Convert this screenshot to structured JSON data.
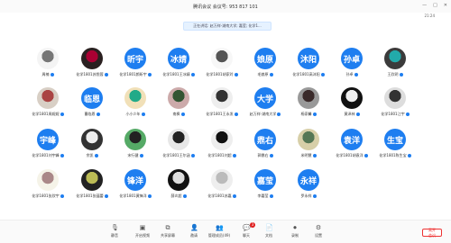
{
  "title": "腾讯会议 会议号: 953 817 101",
  "status_time": "21:24",
  "speaking_text": "正在讲话: 赵万祥-湖南大学; 嘉莹; 化学1...",
  "participants": [
    {
      "name": "周楠",
      "type": "photo",
      "c1": "#f4f4f4",
      "c2": "#777"
    },
    {
      "name": "化学1801苏悦蓉",
      "type": "photo",
      "c1": "#2a2020",
      "c2": "#a03"
    },
    {
      "name": "化学1801颜昕宇",
      "type": "blue",
      "text": "昕宇"
    },
    {
      "name": "化学1801王冰婧",
      "type": "blue",
      "text": "冰婧"
    },
    {
      "name": "化学1801胡家玲",
      "type": "photo",
      "c1": "#f7f7f7",
      "c2": "#555"
    },
    {
      "name": "毛娘原",
      "type": "blue",
      "text": "娘原"
    },
    {
      "name": "化学1801高沐阳",
      "type": "blue",
      "text": "沐阳"
    },
    {
      "name": "孙卓",
      "type": "blue",
      "text": "孙卓"
    },
    {
      "name": "王欣玥",
      "type": "photo",
      "c1": "#3b3b3b",
      "c2": "#2aa"
    },
    {
      "name": "化学1801周妮妮",
      "type": "photo",
      "c1": "#d8cfc5",
      "c2": "#a44"
    },
    {
      "name": "曹临恩",
      "type": "blue",
      "text": "临恩"
    },
    {
      "name": "小小少年",
      "type": "photo",
      "c1": "#f1e0b8",
      "c2": "#2a8"
    },
    {
      "name": "南枫",
      "type": "photo",
      "c1": "#caa",
      "c2": "#353"
    },
    {
      "name": "化学1801王永发",
      "type": "photo",
      "c1": "#eee",
      "c2": "#333"
    },
    {
      "name": "赵万祥-湖南大学",
      "type": "blue",
      "text": "大学"
    },
    {
      "name": "杨家馨",
      "type": "photo",
      "c1": "#999",
      "c2": "#3a2a2a"
    },
    {
      "name": "黄泽林",
      "type": "photo",
      "c1": "#111",
      "c2": "#eee"
    },
    {
      "name": "化学1801江宇",
      "type": "photo",
      "c1": "#ddd",
      "c2": "#333"
    },
    {
      "name": "化学1801刘宇峰",
      "type": "blue",
      "text": "宇峰"
    },
    {
      "name": "余凯",
      "type": "photo",
      "c1": "#333",
      "c2": "#eee"
    },
    {
      "name": "宋行健",
      "type": "photo",
      "c1": "#5a6",
      "c2": "#222"
    },
    {
      "name": "化学1801王尔涵",
      "type": "photo",
      "c1": "#e7e7e7",
      "c2": "#222"
    },
    {
      "name": "化学1801刘超",
      "type": "photo",
      "c1": "#eee",
      "c2": "#111"
    },
    {
      "name": "郭鼎右",
      "type": "blue",
      "text": "鼎右"
    },
    {
      "name": "米明慧",
      "type": "photo",
      "c1": "#d7cfa8",
      "c2": "#575"
    },
    {
      "name": "化学1801胡袁洋",
      "type": "blue",
      "text": "袁洋"
    },
    {
      "name": "化学1801陈生宝",
      "type": "blue",
      "text": "生宝"
    },
    {
      "name": "化学1801张欣宇",
      "type": "photo",
      "c1": "#f5f3e8",
      "c2": "#a88"
    },
    {
      "name": "化学1801张蕴蕾",
      "type": "photo",
      "c1": "#222",
      "c2": "#bb5"
    },
    {
      "name": "化学1801黄锋洋",
      "type": "blue",
      "text": "锋洋"
    },
    {
      "name": "薛炎超",
      "type": "photo",
      "c1": "#111",
      "c2": "#ddd"
    },
    {
      "name": "化学1801苏嘉",
      "type": "photo",
      "c1": "#eee",
      "c2": "#bbb"
    },
    {
      "name": "李嘉莹",
      "type": "blue",
      "text": "嘉莹"
    },
    {
      "name": "罗永祥",
      "type": "blue",
      "text": "永祥"
    }
  ],
  "toolbar": {
    "items": [
      {
        "label": "静音",
        "icon": "🎙"
      },
      {
        "label": "开启视频",
        "icon": "▣"
      },
      {
        "label": "共享屏幕",
        "icon": "⧉"
      },
      {
        "label": "邀请",
        "icon": "👤"
      },
      {
        "label": "管理成员(49)",
        "icon": "👥"
      },
      {
        "label": "聊天",
        "icon": "💬",
        "badge": "3"
      },
      {
        "label": "文档",
        "icon": "📄"
      },
      {
        "label": "录制",
        "icon": "⏺"
      },
      {
        "label": "设置",
        "icon": "⚙"
      }
    ],
    "leave_label": "离开会议"
  },
  "colors": {
    "accent": "#1e7ef0",
    "leave": "#e33"
  }
}
